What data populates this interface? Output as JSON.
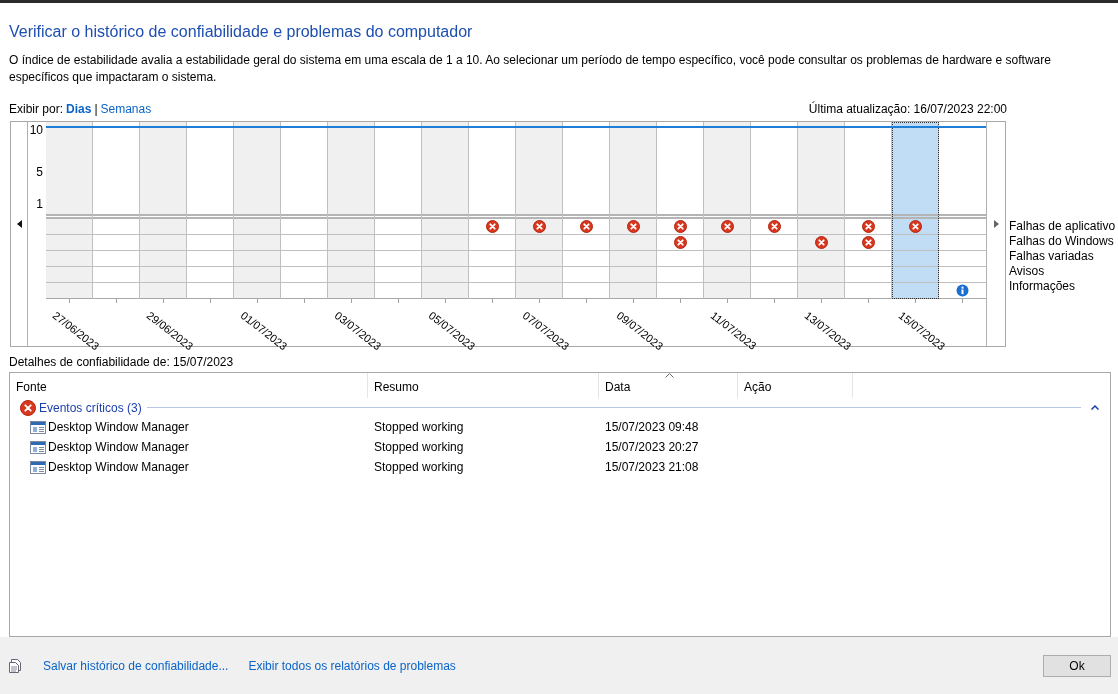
{
  "title": "Verificar o histórico de confiabilidade e problemas do computador",
  "description": "O índice de estabilidade avalia a estabilidade geral do sistema em uma escala de 1 a 10. Ao selecionar um período de tempo específico, você pode consultar os problemas de hardware e software específicos que impactaram o sistema.",
  "view_by": {
    "label": "Exibir por:",
    "separator": "|",
    "options": [
      {
        "label": "Dias",
        "selected": true
      },
      {
        "label": "Semanas",
        "selected": false
      }
    ]
  },
  "last_update": "Última atualização: 16/07/2023 22:00",
  "chart": {
    "yticks": [
      "10",
      "5",
      "1"
    ],
    "days": [
      {
        "label": "27/06/2023",
        "selected": false
      },
      {
        "selected": false
      },
      {
        "label": "29/06/2023",
        "selected": false
      },
      {
        "selected": false
      },
      {
        "label": "01/07/2023",
        "selected": false
      },
      {
        "selected": false
      },
      {
        "label": "03/07/2023",
        "selected": false
      },
      {
        "selected": false
      },
      {
        "label": "05/07/2023",
        "selected": false
      },
      {
        "selected": false
      },
      {
        "label": "07/07/2023",
        "selected": false
      },
      {
        "selected": false
      },
      {
        "label": "09/07/2023",
        "selected": false
      },
      {
        "selected": false
      },
      {
        "label": "11/07/2023",
        "selected": false
      },
      {
        "selected": false
      },
      {
        "label": "13/07/2023",
        "selected": false
      },
      {
        "selected": false
      },
      {
        "label": "15/07/2023",
        "selected": true
      },
      {
        "selected": false
      }
    ],
    "event_rows": [
      {
        "label": "Falhas de aplicativo",
        "kind": "error",
        "marks": [
          false,
          false,
          false,
          false,
          false,
          false,
          false,
          false,
          false,
          true,
          true,
          true,
          true,
          true,
          true,
          true,
          false,
          true,
          true,
          false
        ]
      },
      {
        "label": "Falhas do Windows",
        "kind": "error",
        "marks": [
          false,
          false,
          false,
          false,
          false,
          false,
          false,
          false,
          false,
          false,
          false,
          false,
          false,
          true,
          false,
          false,
          true,
          true,
          false,
          false
        ]
      },
      {
        "label": "Falhas variadas",
        "kind": "error",
        "marks": [
          false,
          false,
          false,
          false,
          false,
          false,
          false,
          false,
          false,
          false,
          false,
          false,
          false,
          false,
          false,
          false,
          false,
          false,
          false,
          false
        ]
      },
      {
        "label": "Avisos",
        "kind": "warning",
        "marks": [
          false,
          false,
          false,
          false,
          false,
          false,
          false,
          false,
          false,
          false,
          false,
          false,
          false,
          false,
          false,
          false,
          false,
          false,
          false,
          false
        ]
      },
      {
        "label": "Informações",
        "kind": "info",
        "marks": [
          false,
          false,
          false,
          false,
          false,
          false,
          false,
          false,
          false,
          false,
          false,
          false,
          false,
          false,
          false,
          false,
          false,
          false,
          false,
          true
        ]
      }
    ]
  },
  "details": {
    "title": "Detalhes de confiabilidade de: 15/07/2023",
    "columns": [
      {
        "label": "Fonte",
        "sorted": false
      },
      {
        "label": "Resumo",
        "sorted": false
      },
      {
        "label": "Data",
        "sorted": true
      },
      {
        "label": "Ação",
        "sorted": false
      }
    ],
    "groups": [
      {
        "label": "Eventos críticos (3)",
        "kind": "error",
        "expanded": true,
        "rows": [
          {
            "source": "Desktop Window Manager",
            "summary": "Stopped working",
            "date": "15/07/2023 09:48"
          },
          {
            "source": "Desktop Window Manager",
            "summary": "Stopped working",
            "date": "15/07/2023 20:27"
          },
          {
            "source": "Desktop Window Manager",
            "summary": "Stopped working",
            "date": "15/07/2023 21:08"
          }
        ]
      }
    ]
  },
  "footer": {
    "links": [
      "Salvar histórico de confiabilidade...",
      "Exibir todos os relatórios de problemas"
    ],
    "ok_button": "Ok"
  }
}
